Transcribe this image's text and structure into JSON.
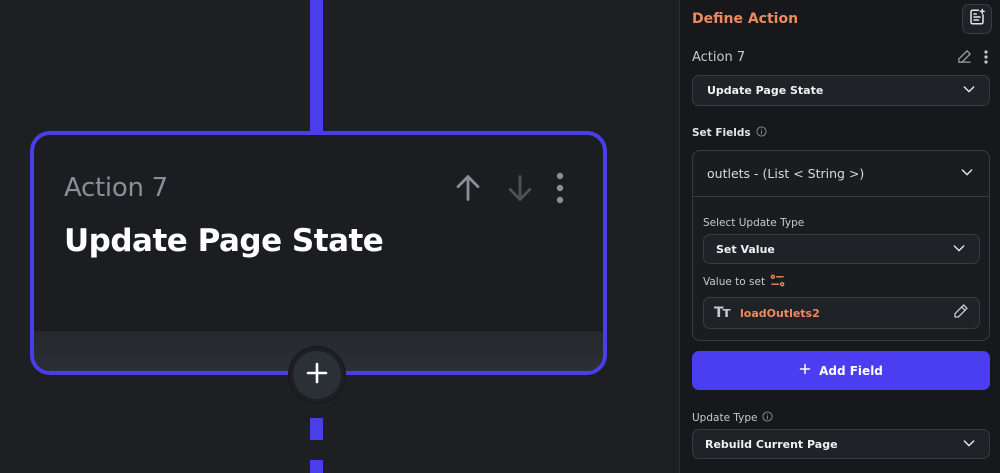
{
  "canvas": {
    "card": {
      "subtitle": "Action 7",
      "title": "Update Page State",
      "icons": [
        "arrow-up-icon",
        "arrow-down-icon",
        "more-vertical-icon"
      ]
    },
    "add_node_icon": "plus-icon"
  },
  "panel": {
    "title": "Define Action",
    "top_icon": "notes-add-icon",
    "action_name": "Action 7",
    "action_type": "Update Page State",
    "set_fields_label": "Set Fields",
    "field": {
      "name": "outlets - (List < String >)",
      "update_type_label": "Select Update Type",
      "update_type_value": "Set Value",
      "value_label": "Value to set",
      "value": "loadOutlets2",
      "value_type_glyph": "Tт"
    },
    "add_field_label": "Add Field",
    "rebuild_label": "Update Type",
    "rebuild_value": "Rebuild Current Page"
  },
  "colors": {
    "accent": "#4a3dea",
    "orange": "#ee8a5e",
    "background": "#1d1f23",
    "panel": "#16181c"
  }
}
